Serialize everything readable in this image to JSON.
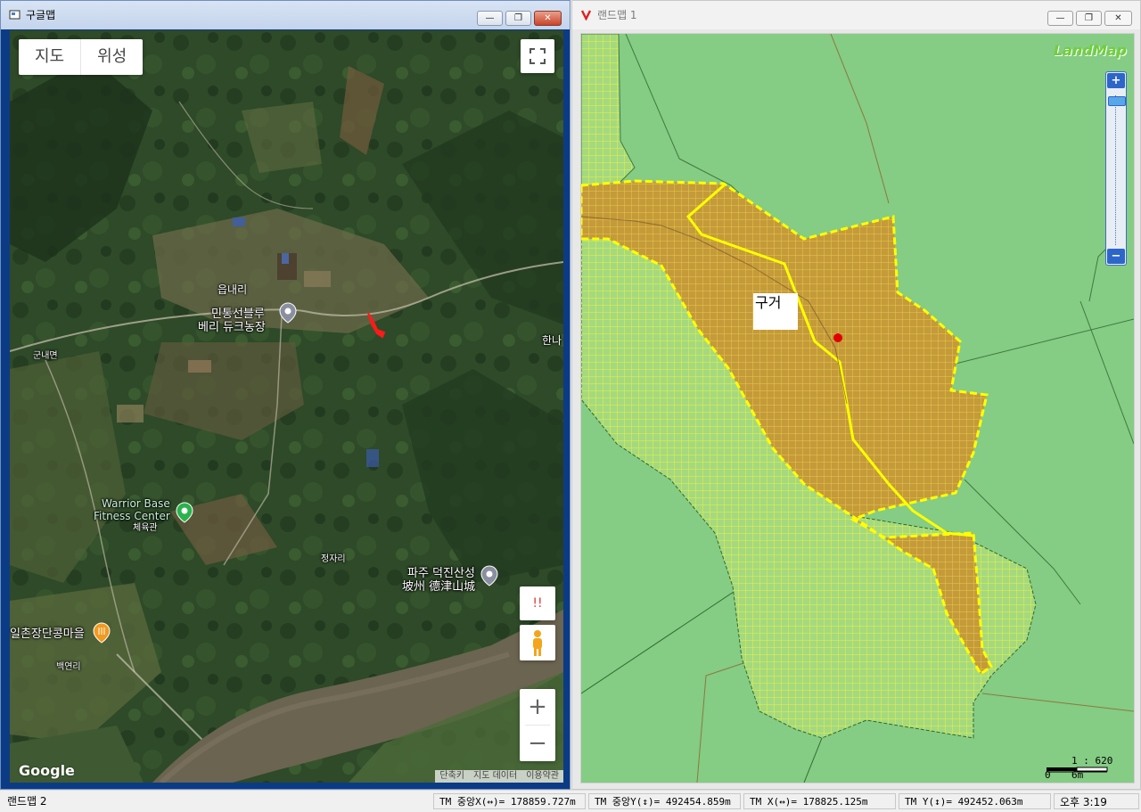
{
  "left_window": {
    "title": "구글맵",
    "controls": {
      "map_label": "지도",
      "satellite_label": "위성",
      "alert_glyph": "!!",
      "zoom_in": "+",
      "zoom_out": "−"
    },
    "labels": {
      "eupnaeri": "읍내리",
      "farm_line1": "민통선블루",
      "farm_line2": "베리 듀크농장",
      "gunnaemyeon": "군내면",
      "hanna": "한나",
      "warrior1": "Warrior Base",
      "warrior2": "Fitness Center",
      "cheyukgwan": "체육관",
      "jeongjari": "정자리",
      "fort1": "파주 덕진산성",
      "fort2": "坡州 德津山城",
      "village": "일촌장단콩마을",
      "baegyeonri": "백연리"
    },
    "google_logo": "Google",
    "attribution": [
      "단축키",
      "지도 데이터",
      "이용약관"
    ]
  },
  "right_window": {
    "title": "랜드맵 1",
    "logo": "LandMap",
    "label_box": "구거",
    "zoom_plus": "+",
    "zoom_minus": "−",
    "scale_ratio": "1 : 620",
    "scale_zero": "0",
    "scale_unit": "6m"
  },
  "statusbar": {
    "window_name": "랜드맵 2",
    "tm_center_x": "TM 중앙X(↔)= 178859.727m",
    "tm_center_y": "TM 중앙Y(↕)= 492454.859m",
    "tm_x": "TM X(↔)= 178825.125m",
    "tm_y": "TM Y(↕)= 492452.063m",
    "time": "오후 3:19"
  },
  "colors": {
    "land_green": "#85cc85",
    "parcel_orange": "#c49a3a",
    "parcel_yellow": "#e6ef3a",
    "boundary_yellow": "#ffff00",
    "marker_red": "#e00000"
  },
  "icons": [
    "app-icon",
    "minimize-icon",
    "maximize-icon",
    "close-icon",
    "fullscreen-icon",
    "pegman-icon",
    "location-pin-icon",
    "restaurant-icon"
  ]
}
